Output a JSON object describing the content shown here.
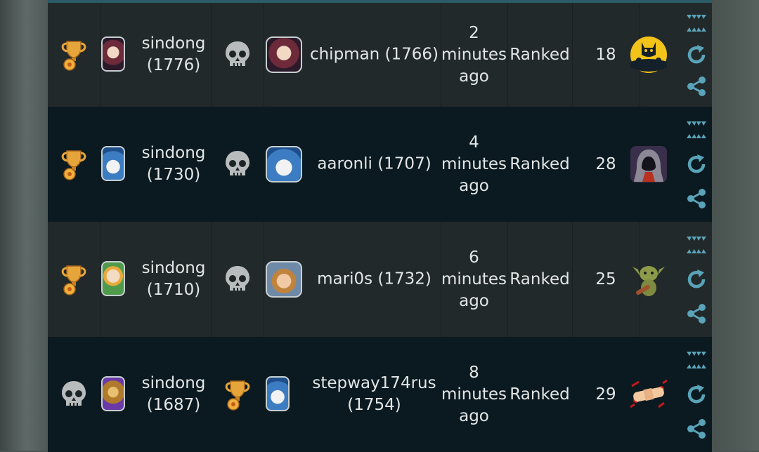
{
  "rows": [
    {
      "player1": {
        "result": "win",
        "name": "sindong",
        "rating": "(1776)",
        "avatar": "red"
      },
      "player2": {
        "result": "loss",
        "name": "chipman (1766)",
        "avatar": "red"
      },
      "time": {
        "line1": "2",
        "line2": "minutes",
        "line3": "ago"
      },
      "mode": "Ranked",
      "turns": "18",
      "map": "cat-map"
    },
    {
      "player1": {
        "result": "win",
        "name": "sindong",
        "rating": "(1730)",
        "avatar": "blue"
      },
      "player2": {
        "result": "loss",
        "name": "aaronli (1707)",
        "avatar": "blue"
      },
      "time": {
        "line1": "4",
        "line2": "minutes",
        "line3": "ago"
      },
      "mode": "Ranked",
      "turns": "28",
      "map": "hooded-map"
    },
    {
      "player1": {
        "result": "win",
        "name": "sindong",
        "rating": "(1710)",
        "avatar": "green"
      },
      "player2": {
        "result": "loss",
        "name": "mari0s (1732)",
        "avatar": "mario"
      },
      "time": {
        "line1": "6",
        "line2": "minutes",
        "line3": "ago"
      },
      "mode": "Ranked",
      "turns": "25",
      "map": "goblin-map"
    },
    {
      "player1": {
        "result": "loss",
        "name": "sindong",
        "rating": "(1687)",
        "avatar": "gold"
      },
      "player2": {
        "result": "win",
        "name": "stepway174rus",
        "rating": "(1754)",
        "avatar": "blue"
      },
      "time": {
        "line1": "8",
        "line2": "minutes",
        "line3": "ago"
      },
      "mode": "Ranked",
      "turns": "29",
      "map": "bandage-map"
    }
  ],
  "icons": {
    "win": "trophy-icon",
    "loss": "skull-icon",
    "actions": [
      "replay-teeth-icon",
      "refresh-icon",
      "share-icon"
    ]
  },
  "colors": {
    "row_light": "#22292b",
    "row_dark": "#0b1a20",
    "text": "#e3e6e6",
    "action_icon": "#5aa3b8",
    "trophy": "#e6a53a",
    "skull": "#b8bcbd"
  }
}
